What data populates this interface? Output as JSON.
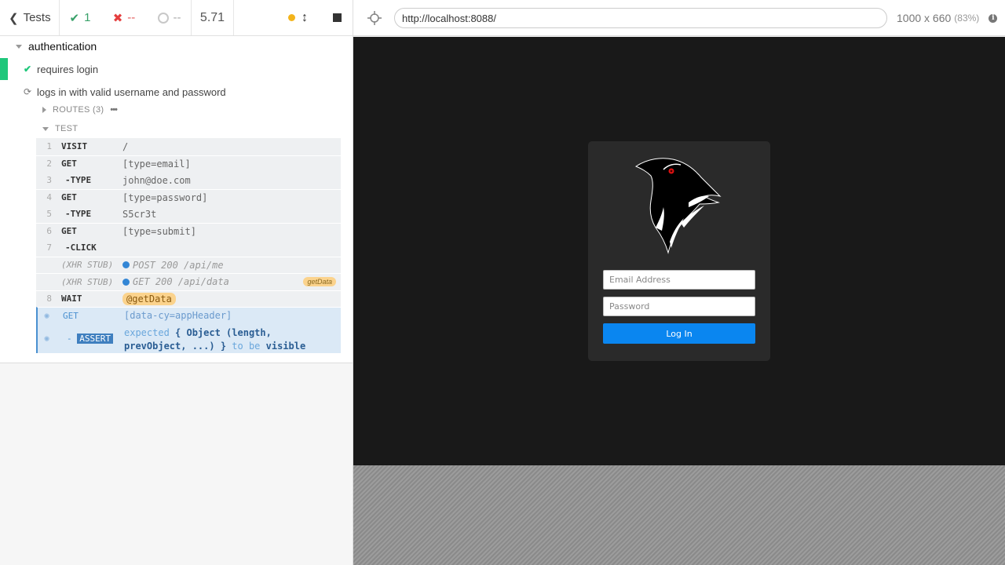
{
  "stats": {
    "tests_label": "Tests",
    "passed": "1",
    "failed": "--",
    "pending": "--",
    "duration": "5.71"
  },
  "suite": {
    "title": "authentication",
    "tests": [
      {
        "title": "requires login",
        "state": "passed"
      },
      {
        "title": "logs in with valid username and password",
        "state": "running"
      }
    ],
    "routes_label": "ROUTES (3)",
    "test_label": "TEST"
  },
  "commands": [
    {
      "num": "1",
      "name": "VISIT",
      "message": "/"
    },
    {
      "num": "2",
      "name": "GET",
      "message": "[type=email]"
    },
    {
      "num": "3",
      "name": "-TYPE",
      "message": "john@doe.com"
    },
    {
      "num": "4",
      "name": "GET",
      "message": "[type=password]"
    },
    {
      "num": "5",
      "name": "-TYPE",
      "message": "S5cr3t"
    },
    {
      "num": "6",
      "name": "GET",
      "message": "[type=submit]"
    },
    {
      "num": "7",
      "name": "-CLICK",
      "message": ""
    },
    {
      "num": "",
      "name": "(XHR STUB)",
      "message": "POST 200 /api/me"
    },
    {
      "num": "",
      "name": "(XHR STUB)",
      "message": "GET 200 /api/data",
      "alias": "getData"
    },
    {
      "num": "8",
      "name": "WAIT",
      "message": "@getData"
    },
    {
      "num": "",
      "name": "GET",
      "message": "[data-cy=appHeader]"
    }
  ],
  "assert_cmd": {
    "prefix": "-",
    "name": "ASSERT",
    "expected": "expected",
    "object": "{ Object (length, prevObject, ...) }",
    "to_be": "to be",
    "visible": "visible"
  },
  "aut": {
    "url": "http://localhost:8088/",
    "viewport": "1000 x 660",
    "scale": "(83%)"
  },
  "login": {
    "email_placeholder": "Email Address",
    "password_placeholder": "Password",
    "button_label": "Log In"
  },
  "colors": {
    "pass": "#1fc77b",
    "fail": "#e53e3e",
    "aut_bg": "#191919",
    "button": "#0a86f0"
  }
}
